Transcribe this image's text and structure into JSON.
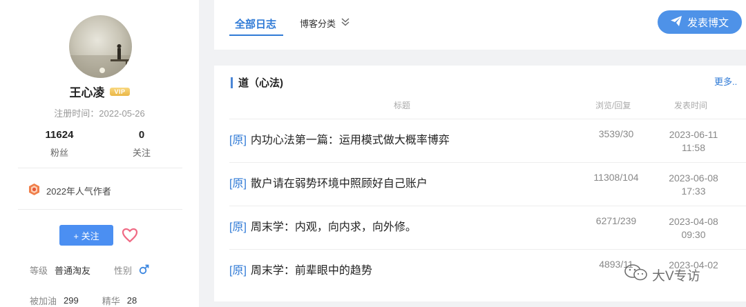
{
  "profile": {
    "username": "王心凌",
    "vip_label": "VIP",
    "register_date": "注册时间：2022-05-26",
    "fans_count": "11624",
    "fans_label": "粉丝",
    "follow_count": "0",
    "follow_label": "关注",
    "award": "2022年人气作者",
    "follow_button": "+ 关注",
    "level_label": "等级",
    "level_value": "普通淘友",
    "gender_label": "性别",
    "gender_icon": "male-icon",
    "cheer_label": "被加油",
    "cheer_value": "299",
    "essence_label": "精华",
    "essence_value": "28"
  },
  "tabs": {
    "all": "全部日志",
    "category": "博客分类"
  },
  "post_button": "发表博文",
  "section": {
    "title": "道（心法)",
    "more": "更多..",
    "col_title": "标题",
    "col_views": "浏览/回复",
    "col_date": "发表时间"
  },
  "articles": [
    {
      "tag": "[原]",
      "title": "内功心法第一篇：运用模式做大概率博弈",
      "views": "3539/30",
      "date": "2023-06-11",
      "time": "11:58"
    },
    {
      "tag": "[原]",
      "title": "散户请在弱势环境中照顾好自己账户",
      "views": "11308/104",
      "date": "2023-06-08",
      "time": "17:33"
    },
    {
      "tag": "[原]",
      "title": "周末学：内观，向内求，向外修。",
      "views": "6271/239",
      "date": "2023-04-08",
      "time": "09:30"
    },
    {
      "tag": "[原]",
      "title": "周末学：前辈眼中的趋势",
      "views": "4893/11",
      "date": "2023-04-02",
      "time": ""
    }
  ],
  "watermark": "大V专访",
  "colors": {
    "accent": "#2f7ad6",
    "button": "#4b8ff2",
    "vip": "#e9b646"
  }
}
